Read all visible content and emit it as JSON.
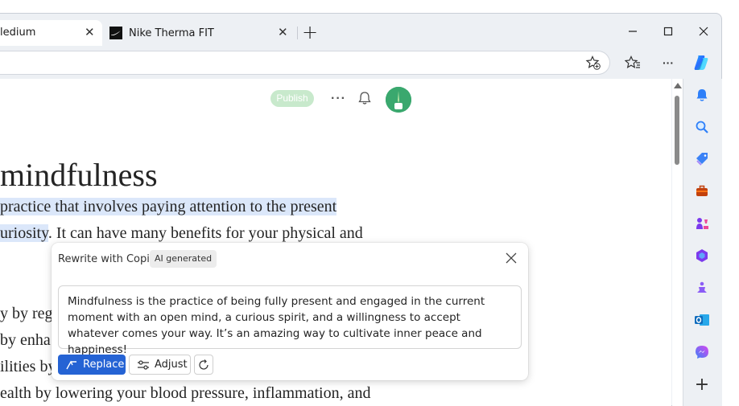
{
  "tabs": [
    {
      "title": "ledium",
      "close": "✕"
    },
    {
      "title": "Nike Therma FIT",
      "close": "✕"
    }
  ],
  "window_controls": {
    "minimize": "—",
    "maximize": "☐",
    "close": "✕"
  },
  "new_tab": "+",
  "toolbar": {
    "more": "···"
  },
  "page": {
    "publish_label": "Publish",
    "more_dots": "···",
    "heading": "mindfulness",
    "lines": [
      {
        "pre": "",
        "hl": "practice that involves paying attention to the present",
        "post": ""
      },
      {
        "pre": "",
        "hl": "uriosity",
        "post": ". It can have many benefits for your physical and"
      },
      {
        "pre": "",
        "hl": "",
        "post": "y by regu"
      },
      {
        "pre": "",
        "hl": "",
        "post": "by enha"
      },
      {
        "pre": "",
        "hl": "",
        "post": "ilities by increasing your focus and memory"
      },
      {
        "pre": "",
        "hl": "",
        "post": "ealth by lowering your blood pressure, inflammation, and"
      }
    ]
  },
  "copilot": {
    "title": "Rewrite with Copilot",
    "badge": "AI generated",
    "close": "✕",
    "suggestion": "Mindfulness is the practice of being fully present and engaged in the current moment with an open mind, a curious spirit, and a willingness to accept whatever comes your way. It’s an amazing way to cultivate inner peace and happiness!",
    "replace_label": "Replace",
    "adjust_label": "Adjust"
  },
  "sidebar": {
    "items": [
      "bell-icon",
      "search-icon",
      "tag-icon",
      "briefcase-icon",
      "games-icon",
      "office-icon",
      "meditation-icon",
      "outlook-icon",
      "messenger-icon",
      "add-icon"
    ],
    "add": "+"
  },
  "colors": {
    "accent": "#2563d4",
    "highlight": "#dbe7fa",
    "publish_bg": "#c8e9cc"
  }
}
